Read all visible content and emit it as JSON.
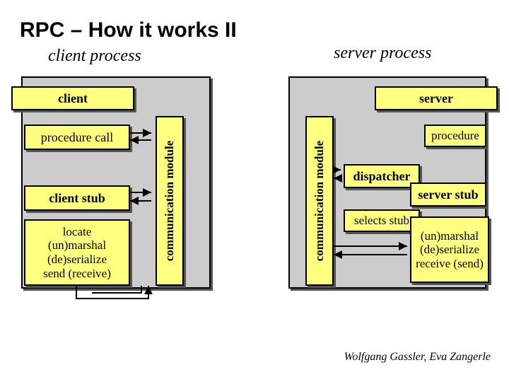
{
  "title": "RPC – How it works II",
  "client_process_label": "client process",
  "server_process_label": "server process",
  "client": {
    "header": "client",
    "procedure_call": "procedure call",
    "stub": "client stub",
    "ops": [
      "locate",
      "(un)marshal",
      "(de)serialize",
      "send (receive)"
    ]
  },
  "server": {
    "header": "server",
    "procedure": "procedure",
    "dispatcher": "dispatcher",
    "stub": "server stub",
    "selects_stub": "selects stub",
    "ops": [
      "(un)marshal",
      "(de)serialize",
      "receive (send)"
    ]
  },
  "comm_module": "communication module",
  "credit": "Wolfgang Gassler, Eva Zangerle"
}
